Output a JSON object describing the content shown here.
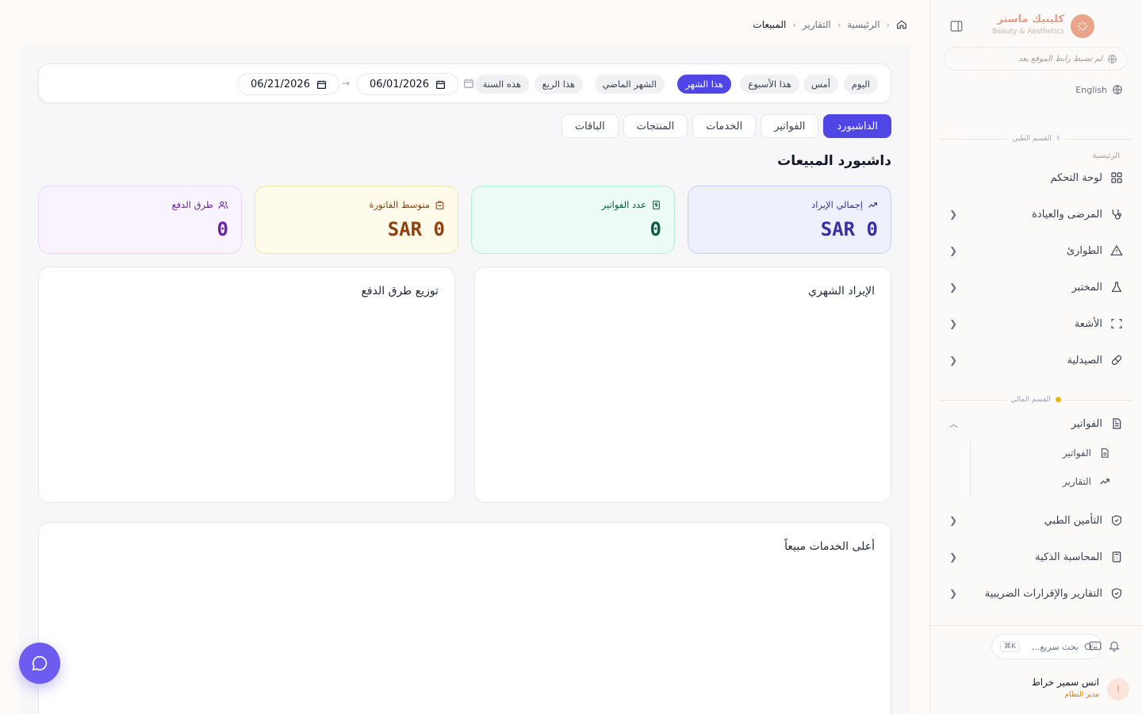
{
  "sidebar": {
    "brand_name": "كلينيك ماستر",
    "brand_sub": "Beauty & Aesthetics",
    "site_link": "لم تضبط رابط الموقع بعد",
    "language": "English",
    "medical_section": "القسم الطبي",
    "main_label": "الرئيسية",
    "items": [
      {
        "label": "لوحة التحكم"
      },
      {
        "label": "المرضى والعيادة"
      },
      {
        "label": "الطوارئ"
      },
      {
        "label": "المختبر"
      },
      {
        "label": "الأشعة"
      },
      {
        "label": "الصيدلية"
      }
    ],
    "finance_section": "القسم المالي",
    "finance_items": [
      {
        "label": "الفواتير"
      },
      {
        "label": "التأمين الطبي"
      },
      {
        "label": "المحاسبة الذكية"
      },
      {
        "label": "التقارير والإقرارات الضريبية"
      }
    ],
    "invoice_sub": [
      {
        "label": "الفواتير"
      },
      {
        "label": "التقارير"
      }
    ],
    "search_placeholder": "بحث سريع...",
    "search_shortcut": "⌘K",
    "user_initial": "ا",
    "user_name": "انس سمير خراط",
    "user_role": "مدير النظام"
  },
  "breadcrumb": {
    "home_icon": "home-icon",
    "items": [
      "الرئيسية",
      "التقارير",
      "المبيعات"
    ]
  },
  "filters": {
    "quick": [
      "اليوم",
      "أمس",
      "هذا الأسبوع",
      "هذا الشهر",
      "الشهر الماضي",
      "هذا الربع",
      "هذه السنة"
    ],
    "active": "هذا الشهر",
    "from_date": "06/01/2026",
    "to_date": "06/21/2026",
    "arrow": "→"
  },
  "tabs": [
    "الداشبورد",
    "الفواتير",
    "الخدمات",
    "المنتجات",
    "الباقات"
  ],
  "active_tab": "الداشبورد",
  "page_title": "داشبورد المبيعات",
  "kpis": [
    {
      "label": "إجمالي الإيراد",
      "value": "SAR 0",
      "color": "#3730a3",
      "bg": "#eef0fd",
      "border": "#c7cdf7",
      "icon": "trend-up-icon"
    },
    {
      "label": "عدد الفواتير",
      "value": "0",
      "color": "#065f46",
      "bg": "#ecfbf4",
      "border": "#b7ecd4",
      "icon": "receipt-icon"
    },
    {
      "label": "متوسط الفاتورة",
      "value": "SAR 0",
      "color": "#92400e",
      "bg": "#fffbea",
      "border": "#f6e3a1",
      "icon": "bag-icon"
    },
    {
      "label": "طرق الدفع",
      "value": "0",
      "color": "#6b21a8",
      "bg": "#f8f3fe",
      "border": "#e6d5fa",
      "icon": "users-icon"
    }
  ],
  "cards": {
    "monthly_revenue": "الإيراد الشهري",
    "payment_methods": "توزيع طرق الدفع",
    "top_services": "أعلى الخدمات مبيعاً"
  },
  "colors": {
    "accent": "#4f46e5",
    "brand": "#e9a489",
    "fab": "#6d5cf0"
  }
}
